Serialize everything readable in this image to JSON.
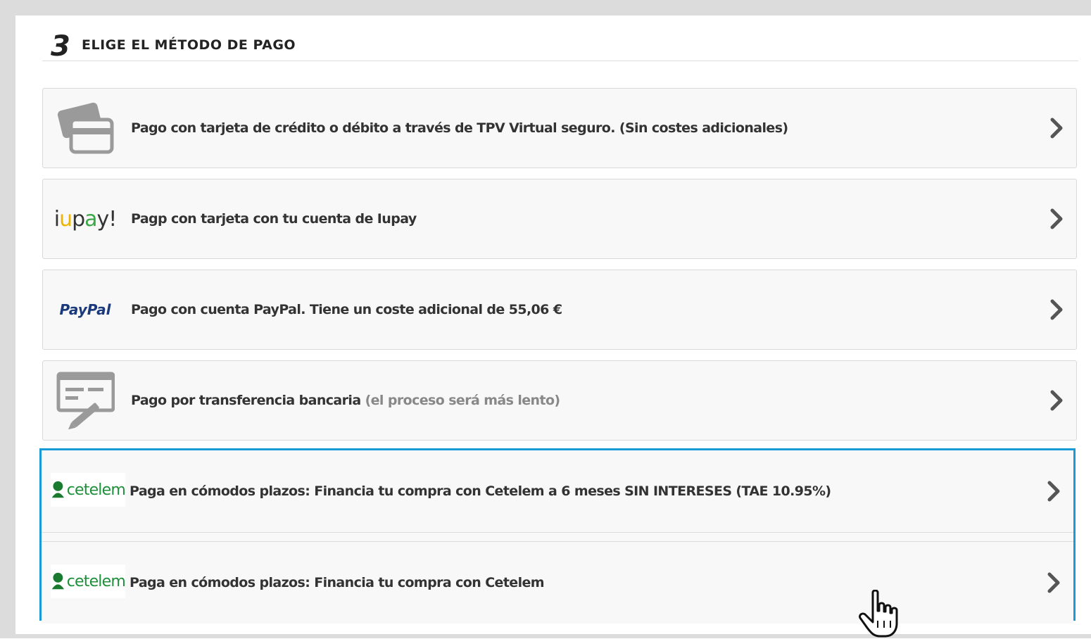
{
  "section": {
    "step_number": "3",
    "title": "ELIGE EL MÉTODO DE PAGO"
  },
  "payment_options": [
    {
      "icon": "credit-card-icon",
      "label": "Pago con tarjeta de crédito o débito a través de TPV Virtual seguro. (Sin costes adicionales)"
    },
    {
      "icon": "iupay-logo",
      "logo_text": "iupay!",
      "label": "Pagp con tarjeta con tu cuenta de Iupay"
    },
    {
      "icon": "paypal-logo",
      "logo_text": "PayPal",
      "label": "Pago con cuenta PayPal. Tiene un coste adicional de 55,06 €"
    },
    {
      "icon": "bank-transfer-icon",
      "label": "Pago por transferencia bancaria",
      "note": "(el proceso será más lento)"
    }
  ],
  "financing_options": [
    {
      "logo_text": "cetelem",
      "label": "Paga en cómodos plazos: Financia tu compra con Cetelem a 6 meses SIN INTERESES (TAE 10.95%)"
    },
    {
      "logo_text": "cetelem",
      "label": "Paga en cómodos plazos: Financia tu compra con Cetelem"
    }
  ],
  "colors": {
    "highlight_border": "#1a9ad6",
    "option_background": "#f8f8f8",
    "cetelem_green": "#1e8f3a",
    "paypal_blue": "#1b3a7c"
  }
}
